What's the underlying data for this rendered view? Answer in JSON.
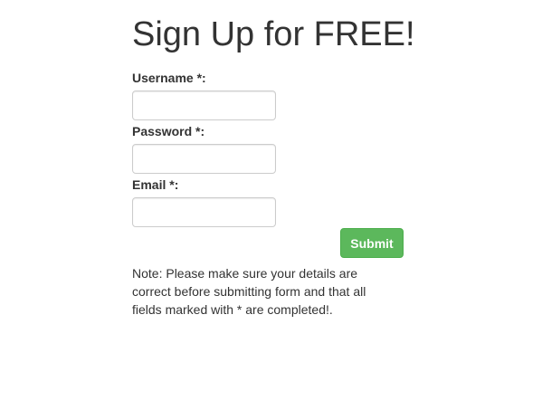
{
  "page": {
    "title": "Sign Up for FREE!"
  },
  "form": {
    "username": {
      "label": "Username *:",
      "value": "",
      "placeholder": ""
    },
    "password": {
      "label": "Password *:",
      "value": "",
      "placeholder": ""
    },
    "email": {
      "label": "Email *:",
      "value": "",
      "placeholder": ""
    },
    "submit_label": "Submit",
    "note": "Note: Please make sure your details are correct before submitting form and that all fields marked with * are completed!."
  },
  "colors": {
    "text": "#333333",
    "input_border": "#cccccc",
    "submit_bg": "#5cb85c",
    "submit_border": "#4cae4c",
    "submit_text": "#ffffff"
  }
}
